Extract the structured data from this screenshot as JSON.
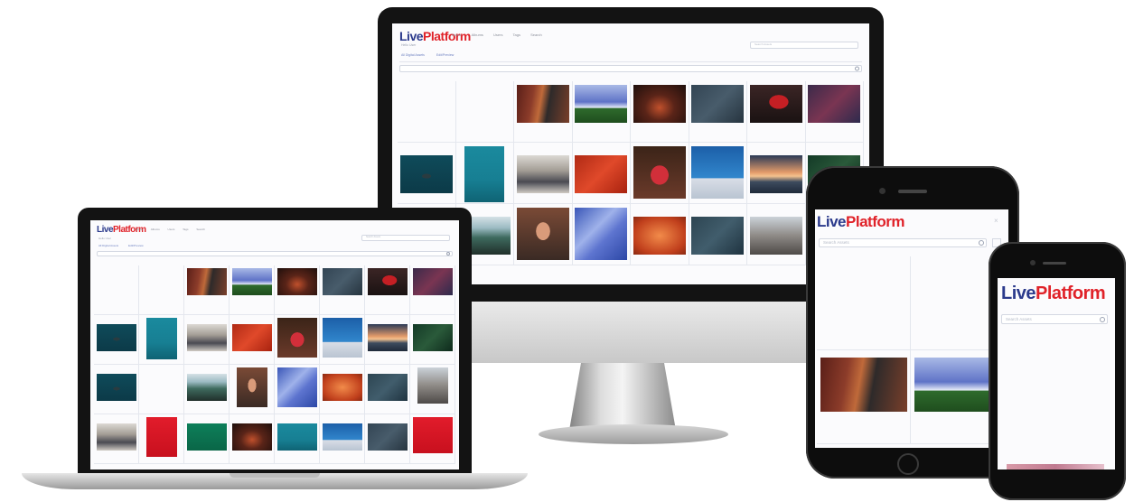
{
  "brand": {
    "live": "Live",
    "platform": "Platform"
  },
  "desktop": {
    "nav": [
      "Home",
      "Albums",
      "Users",
      "Tags",
      "Search"
    ],
    "subtitle": "Hello User",
    "breadcrumb": [
      "All Digital Assets",
      "Edit/Preview"
    ],
    "search_placeholder": "Search Assets"
  },
  "laptop": {
    "nav": [
      "Home",
      "Albums",
      "Users",
      "Tags",
      "Search"
    ],
    "subtitle": "Hello User",
    "breadcrumb": [
      "All Digital Assets",
      "Edit/Preview"
    ],
    "search_placeholder": "Search Assets"
  },
  "tablet": {
    "search_placeholder": "Search Assets"
  },
  "phone": {
    "search_placeholder": "Search Assets"
  },
  "colors": {
    "brand_blue": "#2b3a8c",
    "brand_red": "#e02229",
    "bezel": "#131313"
  }
}
